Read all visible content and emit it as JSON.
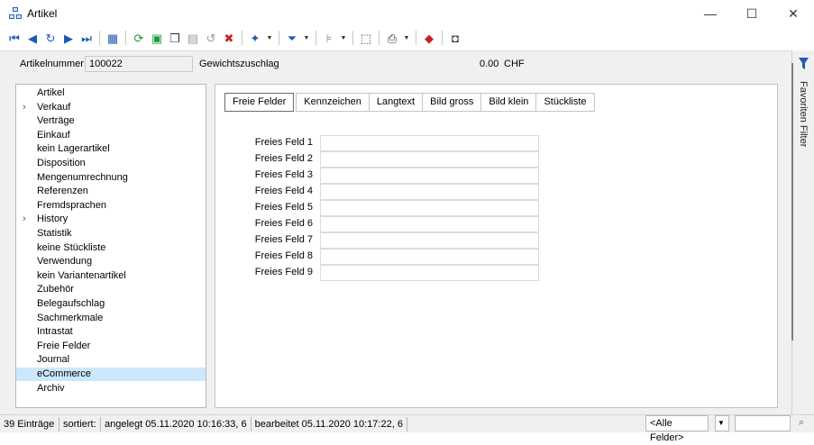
{
  "window": {
    "title": "Artikel",
    "controls": {
      "minimize": "—",
      "maximize": "☐",
      "close": "✕"
    }
  },
  "toolbar": {
    "icons": [
      "first-record-icon",
      "previous-record-icon",
      "search-record-icon",
      "next-record-icon",
      "last-record-icon",
      "table-view-icon",
      "refresh-icon",
      "new-record-icon",
      "copy-record-icon",
      "save-icon",
      "undo-icon",
      "delete-icon",
      "pin-icon",
      "filter-icon",
      "tree-icon",
      "select-icon",
      "print-icon",
      "export-icon",
      "window-icon"
    ]
  },
  "header": {
    "article_no_label": "Artikelnummer",
    "article_no_value": "100022",
    "weight_surcharge_label": "Gewichtszuschlag",
    "weight_surcharge_value": "0.00",
    "currency": "CHF"
  },
  "nav": {
    "items": [
      {
        "label": "Artikel",
        "expandable": false
      },
      {
        "label": "Verkauf",
        "expandable": true
      },
      {
        "label": "Verträge",
        "expandable": false
      },
      {
        "label": "Einkauf",
        "expandable": false
      },
      {
        "label": "kein Lagerartikel",
        "expandable": false
      },
      {
        "label": "Disposition",
        "expandable": false
      },
      {
        "label": "Mengenumrechnung",
        "expandable": false
      },
      {
        "label": "Referenzen",
        "expandable": false
      },
      {
        "label": "Fremdsprachen",
        "expandable": false
      },
      {
        "label": "History",
        "expandable": true
      },
      {
        "label": "Statistik",
        "expandable": false
      },
      {
        "label": "keine Stückliste",
        "expandable": false
      },
      {
        "label": "Verwendung",
        "expandable": false
      },
      {
        "label": "kein Variantenartikel",
        "expandable": false
      },
      {
        "label": "Zubehör",
        "expandable": false
      },
      {
        "label": "Belegaufschlag",
        "expandable": false
      },
      {
        "label": "Sachmerkmale",
        "expandable": false
      },
      {
        "label": "Intrastat",
        "expandable": false
      },
      {
        "label": "Freie Felder",
        "expandable": false
      },
      {
        "label": "Journal",
        "expandable": false
      },
      {
        "label": "eCommerce",
        "expandable": false,
        "selected": true
      },
      {
        "label": "Archiv",
        "expandable": false
      }
    ],
    "expand_glyph": "›"
  },
  "tabs": [
    {
      "label": "Freie Felder",
      "active": true
    },
    {
      "label": "Kennzeichen"
    },
    {
      "label": "Langtext"
    },
    {
      "label": "Bild gross"
    },
    {
      "label": "Bild klein"
    },
    {
      "label": "Stückliste"
    }
  ],
  "free_fields": [
    {
      "label": "Freies Feld 1",
      "value": ""
    },
    {
      "label": "Freies Feld 2",
      "value": ""
    },
    {
      "label": "Freies Feld 3",
      "value": ""
    },
    {
      "label": "Freies Feld 4",
      "value": ""
    },
    {
      "label": "Freies Feld 5",
      "value": ""
    },
    {
      "label": "Freies Feld 6",
      "value": ""
    },
    {
      "label": "Freies Feld 7",
      "value": ""
    },
    {
      "label": "Freies Feld 8",
      "value": ""
    },
    {
      "label": "Freies Feld 9",
      "value": ""
    }
  ],
  "side_panel": {
    "label": "Favoriten Filter"
  },
  "statusbar": {
    "entries": "39 Einträge",
    "sorted_label": "sortiert:",
    "sorted_value": "",
    "created": "angelegt 05.11.2020 10:16:33,",
    "created_user": "6",
    "edited": "bearbeitet 05.11.2020 10:17:22,",
    "edited_user": "6",
    "field_filter": "<Alle Felder>"
  },
  "colors": {
    "selection": "#cce8ff",
    "panel_bg": "#f0f0f0",
    "accent": "#1e5ab4"
  }
}
